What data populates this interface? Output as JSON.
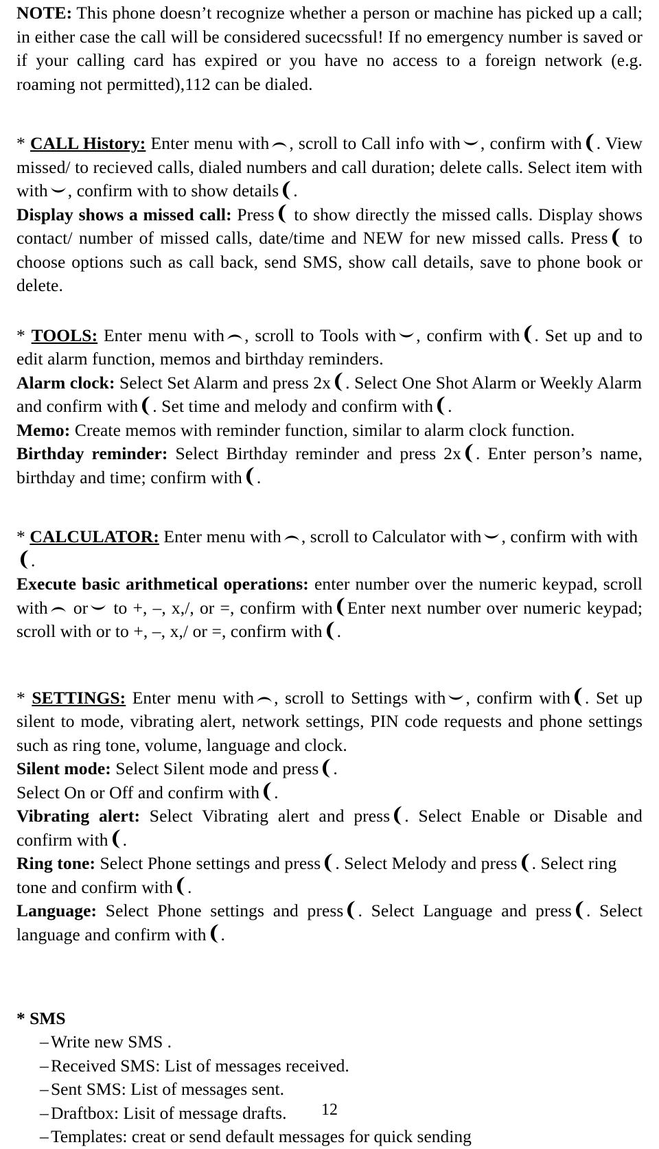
{
  "document": {
    "page_number": "12",
    "icons": {
      "up": "scroll-up-key-icon",
      "down": "scroll-down-key-icon",
      "call": "call-confirm-key-icon"
    }
  },
  "note": {
    "label": "NOTE:",
    "body": " This phone doesn’t recognize whether a person or machine has picked up a call; in either case the call will be considered sucecssful! If no emergency number is saved or if your calling card has expired or you have no access to a foreign network (e.g. roaming not permitted),112 can be dialed."
  },
  "call_history": {
    "bullet": "* ",
    "title": "CALL History:",
    "t1": " Enter menu with",
    "t2": ", scroll to Call info with",
    "t3": ", confirm with",
    "t4": ". View missed/ to recieved calls, dialed numbers and call duration; delete calls. Select item with with",
    "t5": ", confirm with to show details",
    "t6": ".",
    "missed_label": "Display shows a missed call:",
    "m1": " Press",
    "m2": " to show directly the missed calls. Display shows contact/ number of missed calls, date/time and NEW for new missed calls. Press",
    "m3": " to choose options such as call back, send SMS, show call details, save to phone book or delete."
  },
  "tools": {
    "bullet": "* ",
    "title": "TOOLS:",
    "t1": " Enter menu with",
    "t2": ", scroll to Tools with",
    "t3": ", confirm with",
    "t4": ". Set up and to edit alarm function, memos and birthday reminders.",
    "alarm_label": "Alarm clock:",
    "a1": " Select Set Alarm and press 2x",
    "a2": ". Select One Shot Alarm or Weekly Alarm and confirm with",
    "a3": ". Set time and melody and confirm with",
    "a4": ".",
    "memo_label": "Memo:",
    "memo_body": " Create memos with reminder function, similar to alarm clock function.",
    "birthday_label": "Birthday reminder:",
    "b1": " Select Birthday reminder and press 2x",
    "b2": ". Enter person’s name, birthday and time; confirm with",
    "b3": "."
  },
  "calculator": {
    "bullet": "* ",
    "title": "CALCULATOR:",
    "t1": " Enter menu with",
    "t2": ", scroll to Calculator with",
    "t3": ", confirm with with",
    "t4": ".",
    "exec_label": "Execute basic arithmetical operations:",
    "e1": " enter number over the numeric keypad, scroll with",
    "e2": " or",
    "e3": " to +, –, x,/, or =, confirm with",
    "e4": "Enter next number over numeric keypad; scroll with or to +, –, x,/ or =, confirm with",
    "e5": "."
  },
  "settings": {
    "bullet": "* ",
    "title": "SETTINGS:",
    "t1": " Enter menu with",
    "t2": ", scroll to Settings with",
    "t3": ", confirm with",
    "t4": ". Set up silent to mode, vibrating alert, network settings, PIN code requests and phone settings such as ring tone, volume, language and clock.",
    "silent_label": "Silent mode:",
    "s1": " Select Silent mode and press",
    "s2": ".",
    "s3": "Select On or Off   and confirm with",
    "s4": ".",
    "vibrate_label": "Vibrating alert:",
    "v1": " Select Vibrating alert and press",
    "v2": ". Select Enable or Disable and confirm with",
    "v3": ".",
    "ring_label": "Ring tone:",
    "r1": " Select Phone settings and press",
    "r2": ". Select Melody and press",
    "r3": ". Select ring tone and confirm with",
    "r4": ".",
    "lang_label": "Language:",
    "l1": " Select Phone settings and press",
    "l2": ". Select Language and press",
    "l3": ". Select language and confirm with",
    "l4": "."
  },
  "sms": {
    "heading": "* SMS",
    "items": [
      "Write new SMS .",
      "Received SMS: List of messages received.",
      "Sent SMS: List of messages sent.",
      "Draftbox: Lisit of message drafts.",
      "Templates: creat or send default messages for quick sending"
    ],
    "dash": "–"
  }
}
